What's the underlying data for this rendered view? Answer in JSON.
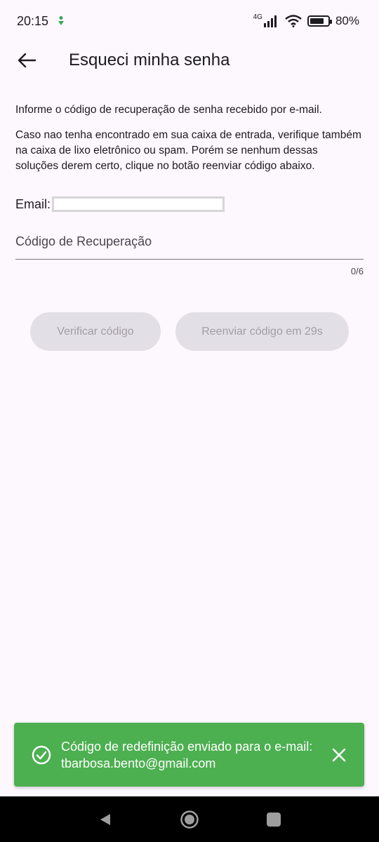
{
  "status_bar": {
    "time": "20:15",
    "network": "4G",
    "battery": "80%",
    "battery_level": 0.8
  },
  "app_bar": {
    "title": "Esqueci minha senha"
  },
  "content": {
    "paragraph1": "Informe o código de recuperação de senha recebido por e-mail.",
    "paragraph2": "Caso nao tenha encontrado em sua caixa de entrada, verifique também na caixa de lixo eletrônico ou spam. Porém se nenhum dessas soluções derem certo, clique no botão reenviar código abaixo.",
    "email_label": "Email:",
    "email_value": "",
    "code_placeholder": "Código de Recuperação",
    "code_value": "",
    "counter": "0/6"
  },
  "buttons": {
    "verify_label": "Verificar código",
    "resend_label": "Reenviar código em 29s"
  },
  "snackbar": {
    "message": "Código de redefinição enviado para o e-mail: tbarbosa.bento@gmail.com",
    "color": "#4caf50"
  },
  "icons": {
    "back": "arrow-left-icon",
    "success": "check-circle-icon",
    "close": "close-icon",
    "nav_back": "triangle-back-icon",
    "nav_home": "circle-home-icon",
    "nav_recents": "square-recents-icon"
  }
}
